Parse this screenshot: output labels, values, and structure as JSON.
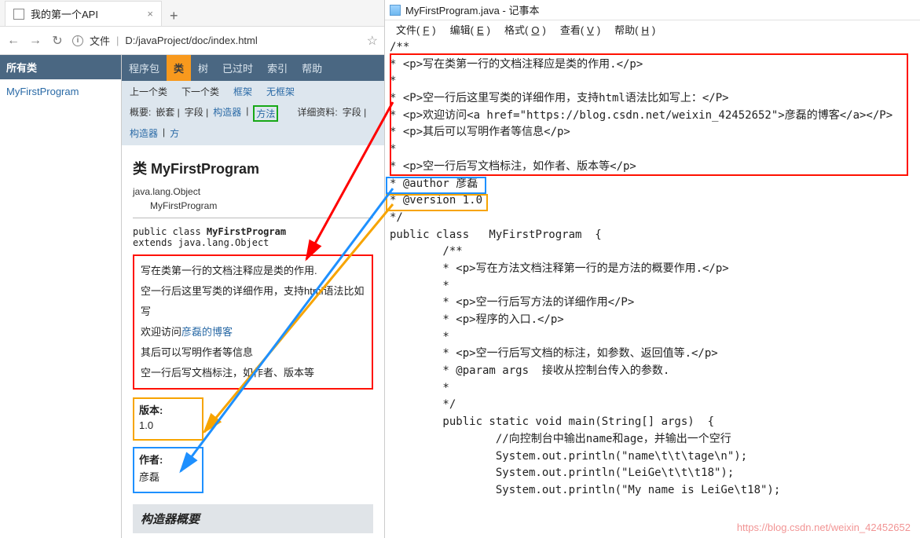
{
  "browser": {
    "tab_title": "我的第一个API",
    "new_tab": "+",
    "tab_close": "×",
    "nav": {
      "back": "←",
      "fwd": "→",
      "reload": "↻",
      "info": "i",
      "star": "☆"
    },
    "addr_label": "文件",
    "addr_url": "D:/javaProject/doc/index.html"
  },
  "sidepane": {
    "header": "所有类",
    "link": "MyFirstProgram"
  },
  "topnav": {
    "pkg": "程序包",
    "cls": "类",
    "tree": "树",
    "depr": "已过时",
    "index": "索引",
    "help": "帮助"
  },
  "subnav": {
    "prev": "上一个类",
    "next": "下一个类",
    "frames": "框架",
    "noframes": "无框架"
  },
  "subnav2": {
    "p1": "概要:",
    "nested": "嵌套 |",
    "field": "字段 |",
    "ctor": "构造器",
    "sep1": " |",
    "method": "方法",
    "p2": "详细资料:",
    "field2": "字段 |",
    "ctor2": "构造器",
    "sep2": " |",
    "method2": "方"
  },
  "doc": {
    "title": "类 MyFirstProgram",
    "inherit1": "java.lang.Object",
    "inherit2": "MyFirstProgram",
    "decl1": "public class ",
    "declName": "MyFirstProgram",
    "decl2": "extends java.lang.Object",
    "desc1": "写在类第一行的文档注释应是类的作用.",
    "desc2": "空一行后这里写类的详细作用，支持html语法比如写",
    "desc3a": "欢迎访问",
    "desc3link": "彦磊的博客",
    "desc4": "其后可以写明作者等信息",
    "desc5": "空一行后写文档标注，如作者、版本等",
    "ver_label": "版本:",
    "ver_val": "1.0",
    "auth_label": "作者:",
    "auth_val": "彦磊",
    "section": "构造器概要"
  },
  "notepad": {
    "title": "MyFirstProgram.java - 记事本",
    "menu": {
      "file": "文件(",
      "fk": "F",
      "file2": ")",
      "edit": "编辑(",
      "ek": "E",
      "edit2": ")",
      "fmt": "格式(",
      "ok": "O",
      "fmt2": ")",
      "view": "查看(",
      "vk": "V",
      "view2": ")",
      "help": "帮助(",
      "hk": "H",
      "help2": ")"
    },
    "lines": [
      "/**",
      "* <p>写在类第一行的文档注释应是类的作用.</p>",
      "*",
      "* <P>空一行后这里写类的详细作用，支持html语法比如写上：</P>",
      "* <p>欢迎访问<a href=\"https://blog.csdn.net/weixin_42452652\">彦磊的博客</a></P>",
      "* <p>其后可以写明作者等信息</p>",
      "*",
      "* <p>空一行后写文档标注，如作者、版本等</p>",
      "* @author 彦磊",
      "* @version 1.0",
      "*/",
      "public class   MyFirstProgram  {",
      "        /**",
      "        * <p>写在方法文档注释第一行的是方法的概要作用.</p>",
      "        *",
      "        * <p>空一行后写方法的详细作用</P>",
      "        * <p>程序的入口.</p>",
      "        *",
      "        * <p>空一行后写文档的标注，如参数、返回值等.</p>",
      "        * @param args  接收从控制台传入的参数.",
      "        *",
      "        */",
      "        public static void main(String[] args)  {",
      "                //向控制台中输出name和age，并输出一个空行",
      "                System.out.println(\"name\\t\\t\\tage\\n\");",
      "",
      "                System.out.println(\"LeiGe\\t\\t\\t18\");",
      "                System.out.println(\"My name is LeiGe\\t18\");"
    ]
  },
  "watermark": "https://blog.csdn.net/weixin_42452652"
}
